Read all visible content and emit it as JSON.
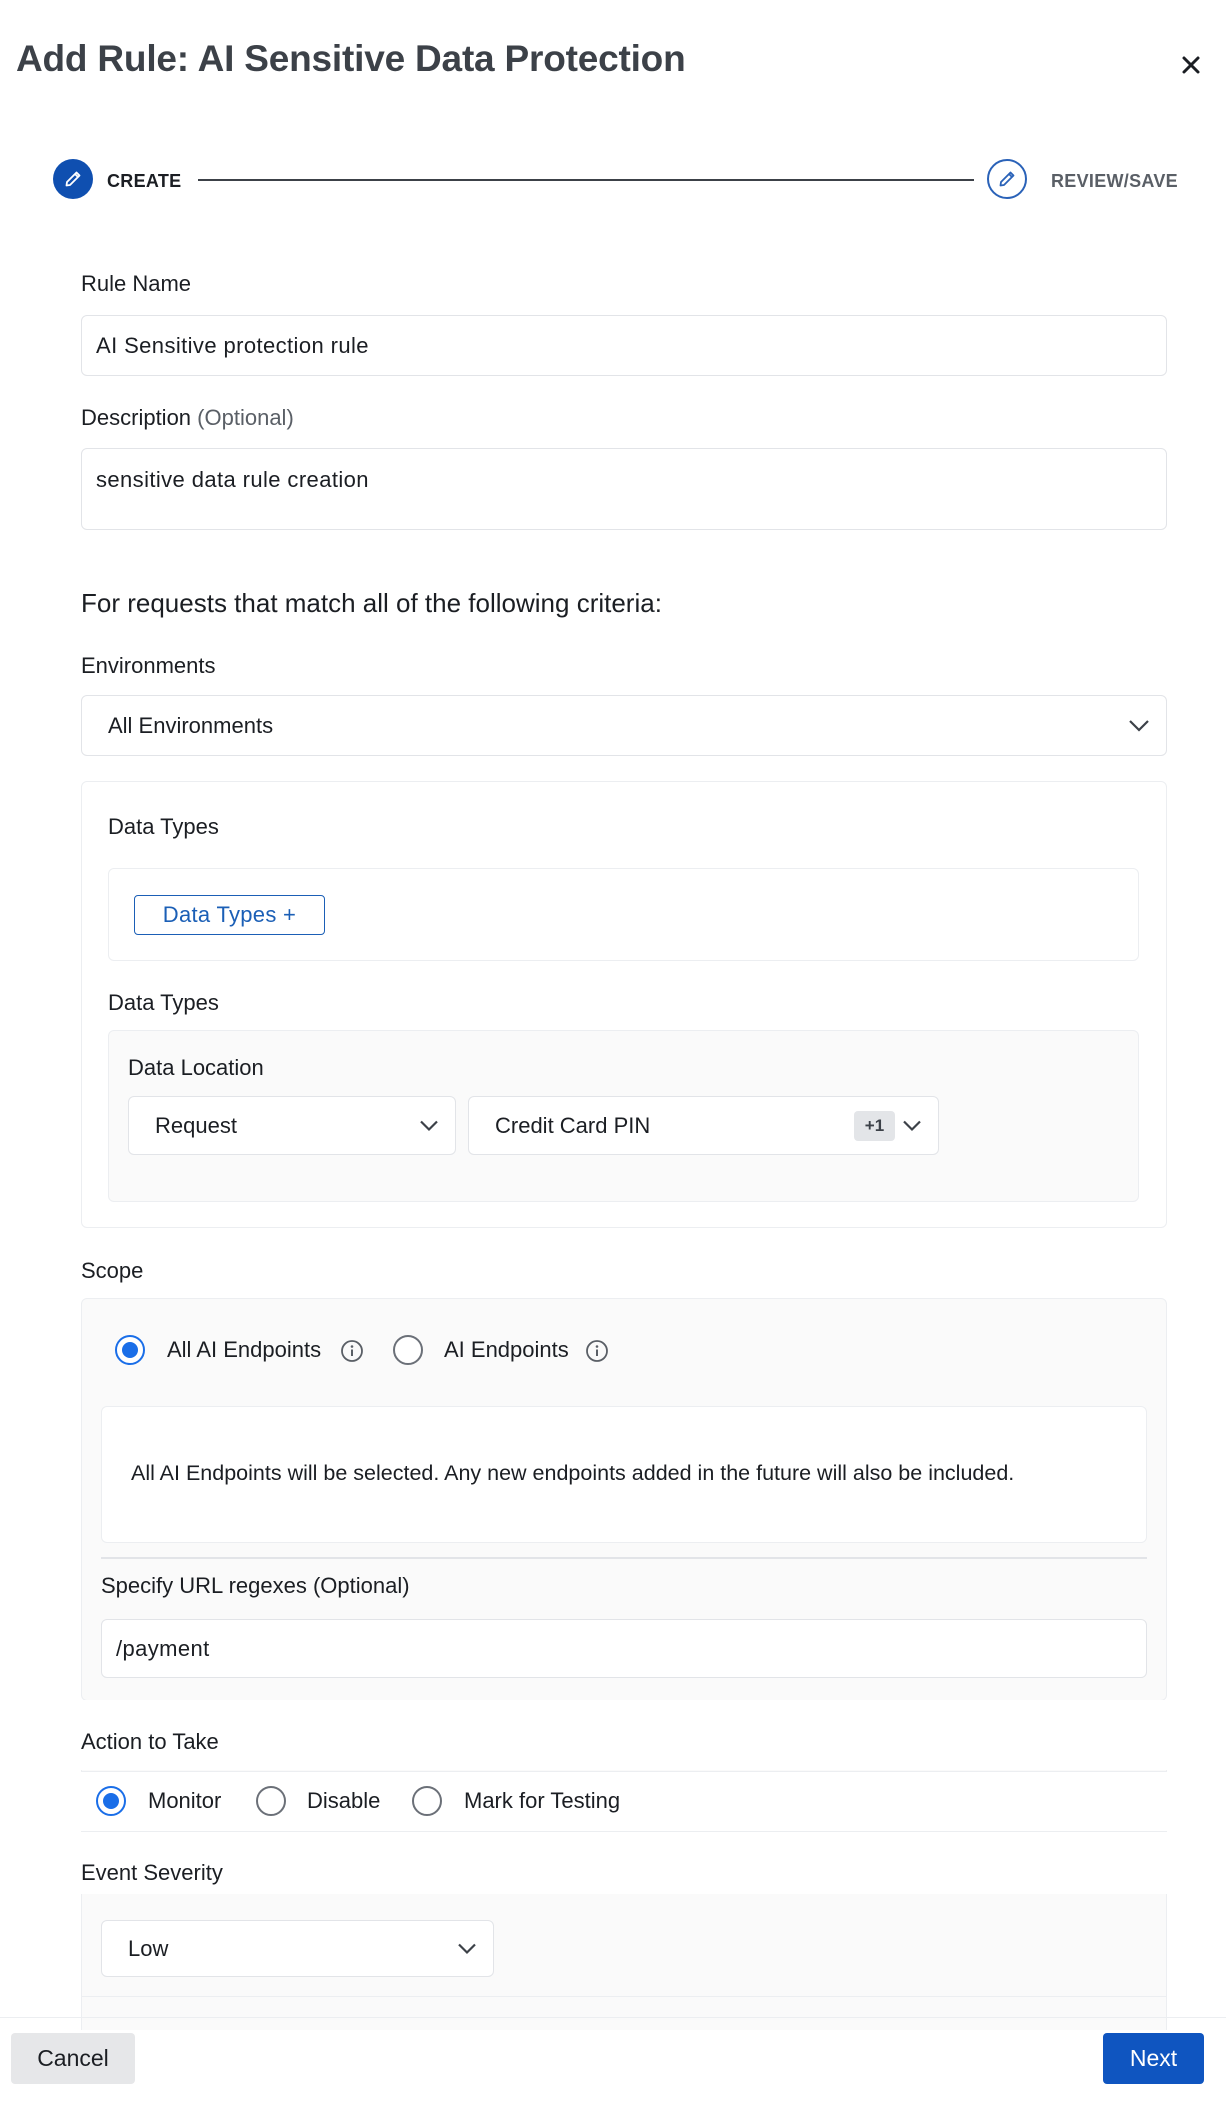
{
  "dialog": {
    "title": "Add Rule: AI Sensitive Data Protection"
  },
  "stepper": {
    "step1_label": "CREATE",
    "step2_label": "REVIEW/SAVE"
  },
  "rule_name": {
    "label": "Rule Name",
    "value": "AI Sensitive protection rule"
  },
  "description": {
    "label": "Description",
    "optional": "(Optional)",
    "value": "sensitive data rule creation"
  },
  "criteria_heading": "For requests that match all of the following criteria:",
  "environments": {
    "label": "Environments",
    "selected": "All Environments"
  },
  "data_types": {
    "heading": "Data Types",
    "add_button": "Data Types +",
    "sub_label": "Data Types",
    "location_label": "Data Location",
    "location_selected": "Request",
    "types_selected": "Credit Card PIN",
    "types_more_badge": "+1"
  },
  "scope": {
    "label": "Scope",
    "option_all": "All AI Endpoints",
    "option_specific": "AI Endpoints",
    "selected": "all",
    "info_text": "All AI Endpoints will be selected. Any new endpoints added in the future will also be included.",
    "url_label": "Specify URL regexes",
    "url_optional": "(Optional)",
    "url_value": "/payment"
  },
  "action": {
    "label": "Action to Take",
    "options": [
      "Monitor",
      "Disable",
      "Mark for Testing"
    ],
    "selected": "Monitor"
  },
  "severity": {
    "label": "Event Severity",
    "selected": "Low"
  },
  "footer": {
    "cancel": "Cancel",
    "next": "Next"
  },
  "colors": {
    "primary": "#0f55c0",
    "radio_active": "#1a6ee8",
    "title_text": "#3c4148"
  },
  "icons": {
    "close": "close-icon",
    "step_create": "pencil-icon",
    "step_review": "pencil-icon",
    "dropdown": "chevron-down-icon",
    "info": "info-icon"
  }
}
